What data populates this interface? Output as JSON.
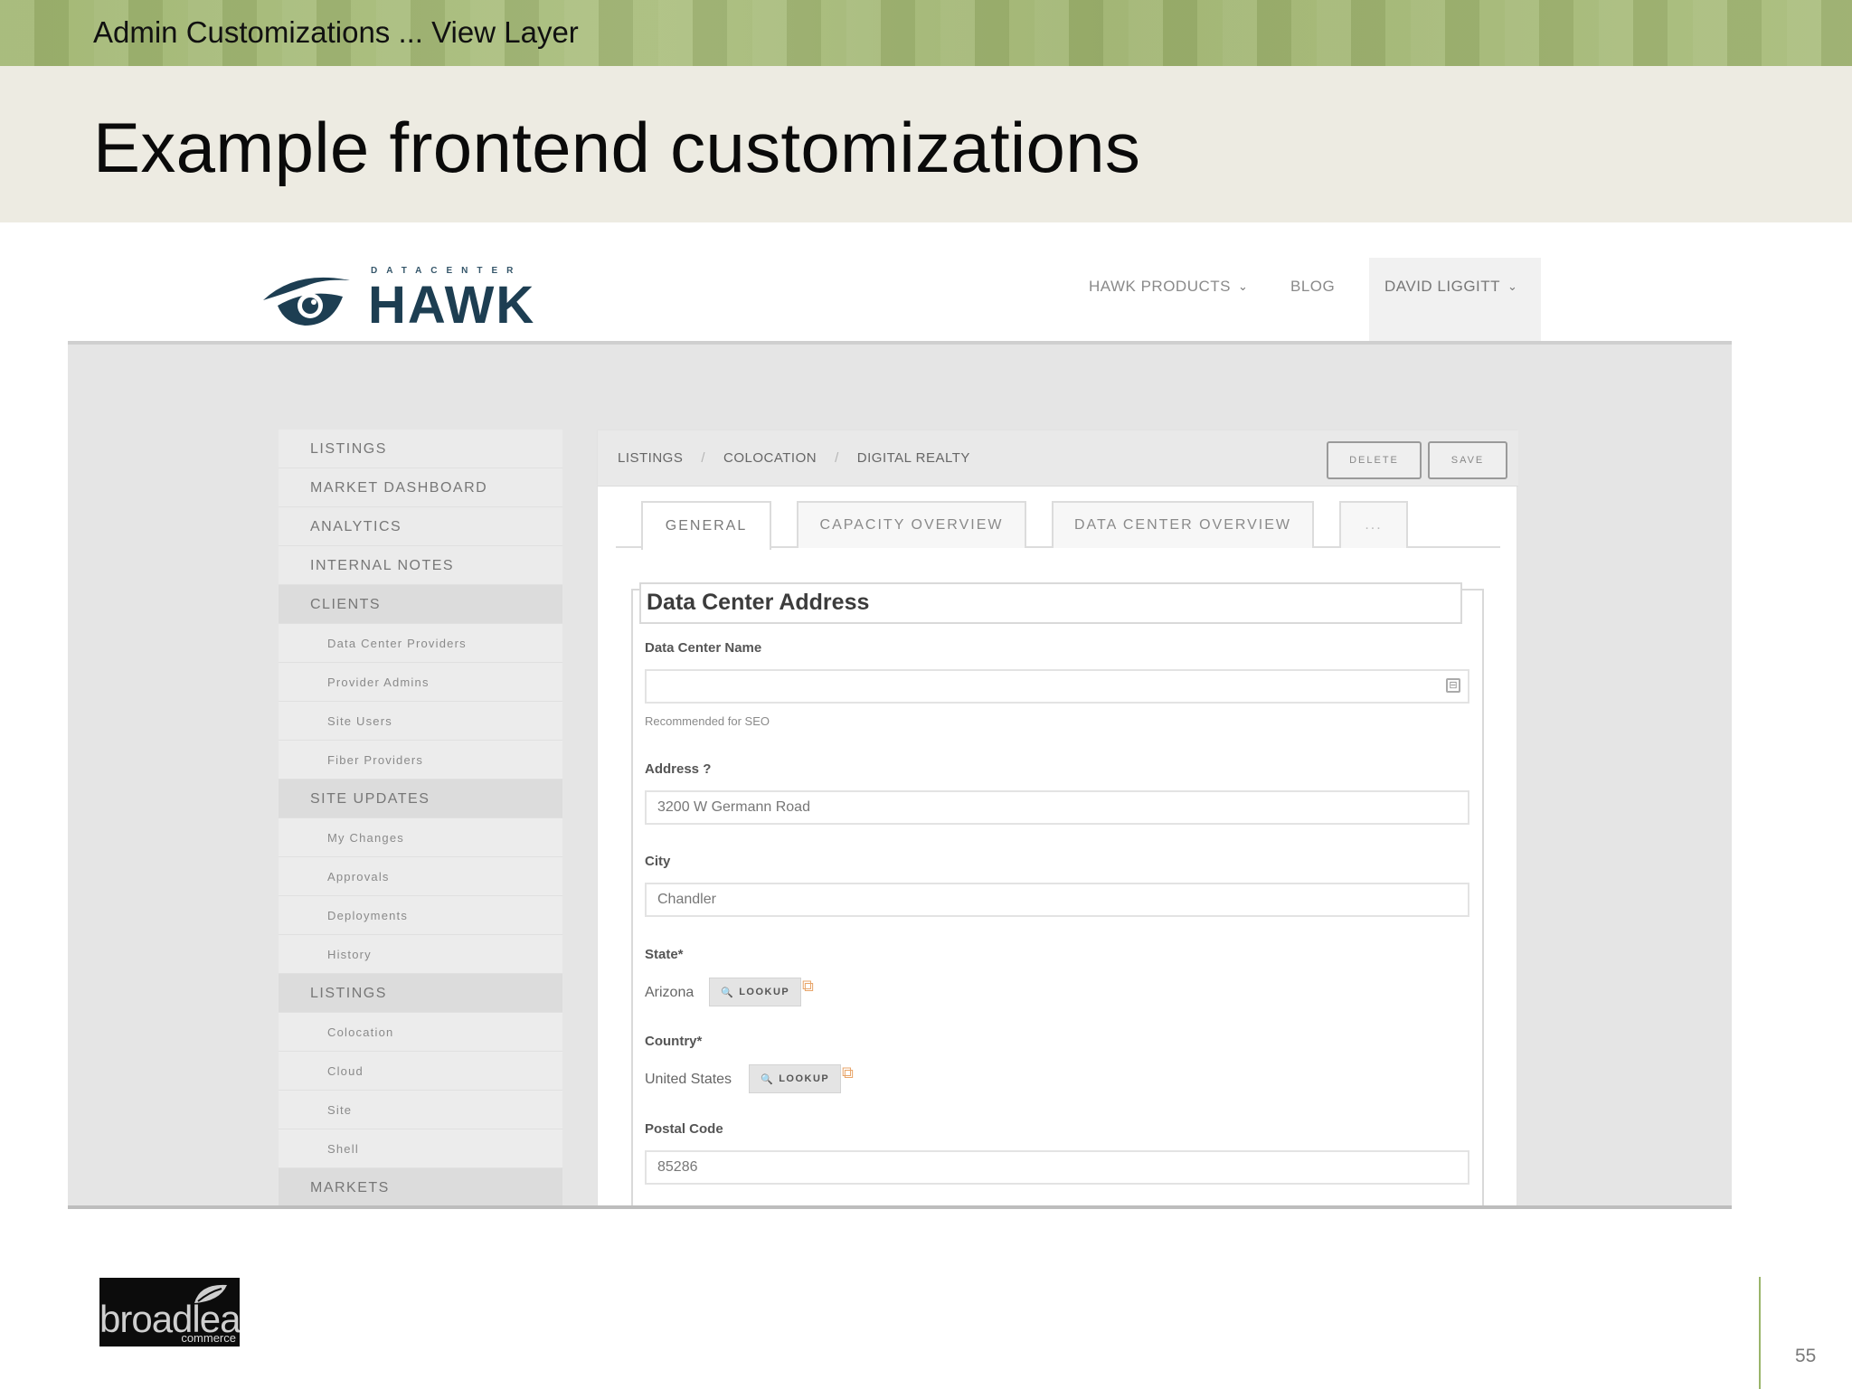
{
  "slide": {
    "section_title": "Admin Customizations ... View Layer",
    "title": "Example frontend customizations",
    "page_number": "55",
    "footer_logo": {
      "text": "broadleaf",
      "sub": "commerce"
    }
  },
  "site": {
    "logo": {
      "tagline": "DATACENTER",
      "name": "HAWK"
    },
    "nav": {
      "products": "HAWK PRODUCTS",
      "blog": "BLOG",
      "user": "DAVID LIGGITT"
    }
  },
  "sidebar": {
    "items": [
      {
        "label": "LISTINGS",
        "kind": "top"
      },
      {
        "label": "MARKET DASHBOARD",
        "kind": "top"
      },
      {
        "label": "ANALYTICS",
        "kind": "top"
      },
      {
        "label": "INTERNAL NOTES",
        "kind": "top"
      },
      {
        "label": "CLIENTS",
        "kind": "section"
      },
      {
        "label": "Data Center Providers",
        "kind": "sub"
      },
      {
        "label": "Provider Admins",
        "kind": "sub"
      },
      {
        "label": "Site Users",
        "kind": "sub"
      },
      {
        "label": "Fiber Providers",
        "kind": "sub"
      },
      {
        "label": "SITE UPDATES",
        "kind": "section"
      },
      {
        "label": "My Changes",
        "kind": "sub"
      },
      {
        "label": "Approvals",
        "kind": "sub"
      },
      {
        "label": "Deployments",
        "kind": "sub"
      },
      {
        "label": "History",
        "kind": "sub"
      },
      {
        "label": "LISTINGS",
        "kind": "section"
      },
      {
        "label": "Colocation",
        "kind": "sub"
      },
      {
        "label": "Cloud",
        "kind": "sub"
      },
      {
        "label": "Site",
        "kind": "sub"
      },
      {
        "label": "Shell",
        "kind": "sub"
      },
      {
        "label": "MARKETS",
        "kind": "section"
      }
    ]
  },
  "panel": {
    "breadcrumb": [
      "LISTINGS",
      "COLOCATION",
      "DIGITAL REALTY"
    ],
    "delete_label": "DELETE",
    "save_label": "SAVE",
    "tabs": {
      "general": "GENERAL",
      "capacity": "CAPACITY OVERVIEW",
      "datacenter": "DATA CENTER OVERVIEW",
      "more": "..."
    },
    "active_tab": "general",
    "form": {
      "legend": "Data Center Address",
      "name_label": "Data Center Name",
      "name_value": "",
      "name_help": "Recommended for SEO",
      "address_label": "Address ?",
      "address_value": "3200 W Germann Road",
      "city_label": "City",
      "city_value": "Chandler",
      "state_label": "State*",
      "state_value": "Arizona",
      "country_label": "Country*",
      "country_value": "United States",
      "lookup_label": "LOOKUP",
      "postal_label": "Postal Code",
      "postal_value": "85286"
    }
  },
  "colors": {
    "band_green": "#a4b876",
    "title_band": "#edebe2",
    "logo_navy": "#1d3e52",
    "page_rule": "#9ab56a"
  }
}
